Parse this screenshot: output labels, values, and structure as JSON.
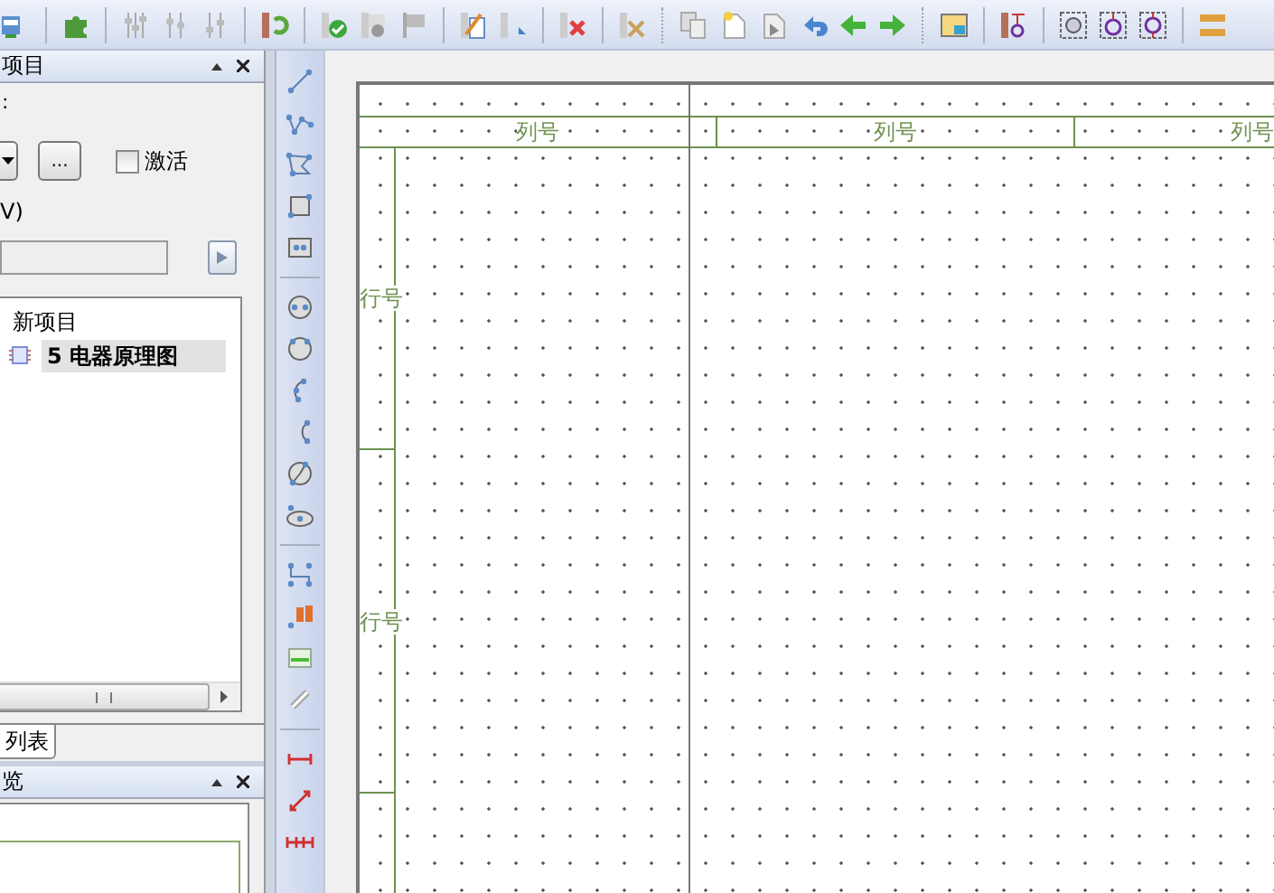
{
  "project_panel": {
    "title": "项目",
    "field_label": ":",
    "browse_button": "...",
    "activate": {
      "label": "激活",
      "checked": false
    },
    "path_label": "V)",
    "tree": [
      {
        "label": "新项目",
        "selected": false,
        "children": [
          {
            "label": "5 电器原理图",
            "selected": true
          }
        ]
      }
    ],
    "tabs": [
      {
        "label": "列表",
        "selected": true
      }
    ]
  },
  "preview_panel": {
    "title": "览"
  },
  "sheet": {
    "columns": [
      "列号",
      "列号",
      "列号"
    ],
    "rows": [
      "行号",
      "行号"
    ]
  }
}
